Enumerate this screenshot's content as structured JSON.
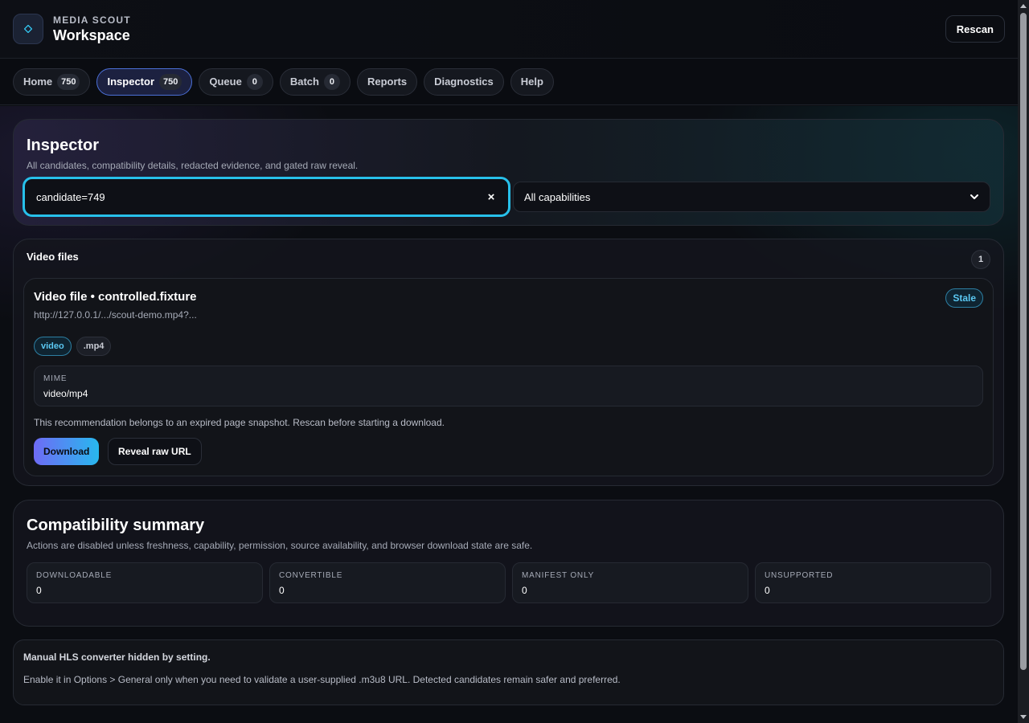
{
  "header": {
    "brand_kicker": "MEDIA SCOUT",
    "brand_title": "Workspace",
    "rescan_label": "Rescan"
  },
  "tabs": [
    {
      "label": "Home",
      "count": "750",
      "active": false
    },
    {
      "label": "Inspector",
      "count": "750",
      "active": true
    },
    {
      "label": "Queue",
      "count": "0",
      "active": false
    },
    {
      "label": "Batch",
      "count": "0",
      "active": false
    },
    {
      "label": "Reports",
      "count": null,
      "active": false
    },
    {
      "label": "Diagnostics",
      "count": null,
      "active": false
    },
    {
      "label": "Help",
      "count": null,
      "active": false
    }
  ],
  "inspector": {
    "title": "Inspector",
    "subtitle": "All candidates, compatibility details, redacted evidence, and gated raw reveal.",
    "search_value": "candidate=749",
    "clear_label": "×",
    "capability_filter": "All capabilities"
  },
  "video_files": {
    "title": "Video files",
    "count": "1",
    "item": {
      "title": "Video file • controlled.fixture",
      "url": "http://127.0.0.1/.../scout-demo.mp4?...",
      "status_badge": "Stale",
      "tags": [
        "video",
        ".mp4"
      ],
      "mime_label": "MIME",
      "mime_value": "video/mp4",
      "note": "This recommendation belongs to an expired page snapshot. Rescan before starting a download.",
      "download_label": "Download",
      "reveal_label": "Reveal raw URL"
    }
  },
  "compatibility": {
    "title": "Compatibility summary",
    "subtitle": "Actions are disabled unless freshness, capability, permission, source availability, and browser download state are safe.",
    "stats": [
      {
        "label": "DOWNLOADABLE",
        "value": "0"
      },
      {
        "label": "CONVERTIBLE",
        "value": "0"
      },
      {
        "label": "MANIFEST ONLY",
        "value": "0"
      },
      {
        "label": "UNSUPPORTED",
        "value": "0"
      }
    ]
  },
  "hls_notice": {
    "title": "Manual HLS converter hidden by setting.",
    "text": "Enable it in Options > General only when you need to validate a user-supplied .m3u8 URL. Detected candidates remain safer and preferred."
  },
  "colors": {
    "accent": "#27c0ea",
    "accent_purple": "#6e6bf5",
    "background": "#0b0d12"
  }
}
